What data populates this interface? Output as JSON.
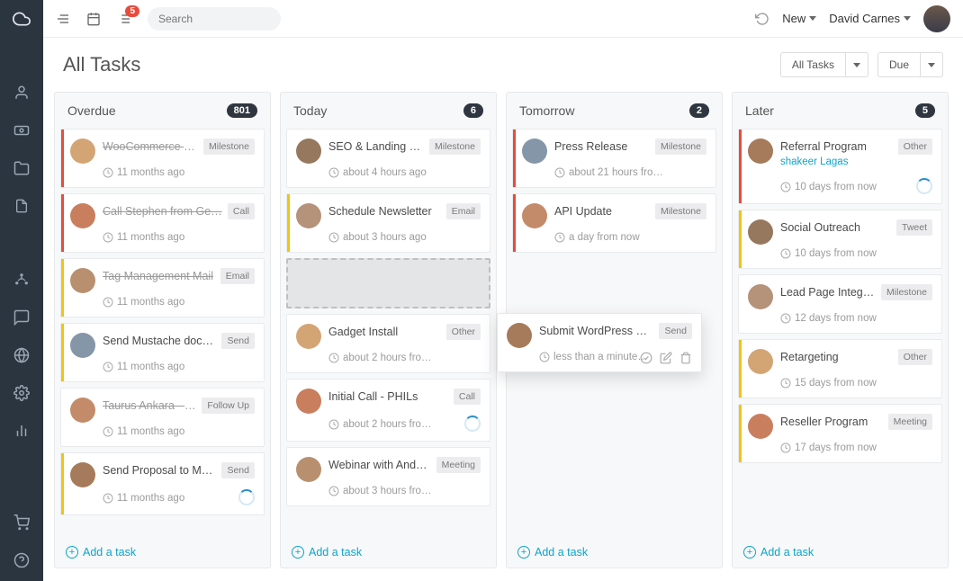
{
  "top": {
    "search_placeholder": "Search",
    "badge": "5",
    "new": "New",
    "user": "David Carnes"
  },
  "header": {
    "title": "All Tasks",
    "filter": "All Tasks",
    "sort": "Due"
  },
  "add_task": "Add a task",
  "columns": [
    {
      "title": "Overdue",
      "count": "801",
      "cards": [
        {
          "stripe": "r",
          "title": "WooCommerce Blog",
          "tag": "Milestone",
          "meta": "11 months ago",
          "done": true
        },
        {
          "stripe": "r",
          "title": "Call Stephen from Ge…",
          "tag": "Call",
          "meta": "11 months ago",
          "done": true
        },
        {
          "stripe": "y",
          "title": "Tag Management Mail",
          "tag": "Email",
          "meta": "11 months ago",
          "done": true
        },
        {
          "stripe": "y",
          "title": "Send Mustache docu…",
          "tag": "Send",
          "meta": "11 months ago"
        },
        {
          "stripe": "n",
          "title": "Taurus Ankara - Foll…",
          "tag": "Follow Up",
          "meta": "11 months ago",
          "done": true
        },
        {
          "stripe": "y",
          "title": "Send Proposal to Mo…",
          "tag": "Send",
          "meta": "11 months ago",
          "spinner": true
        }
      ]
    },
    {
      "title": "Today",
      "count": "6",
      "cards": [
        {
          "stripe": "n",
          "title": "SEO & Landing page",
          "tag": "Milestone",
          "meta": "about 4 hours ago"
        },
        {
          "stripe": "y",
          "title": "Schedule Newsletter",
          "tag": "Email",
          "meta": "about 3 hours ago"
        },
        {
          "drop": true
        },
        {
          "stripe": "n",
          "title": "Gadget Install",
          "tag": "Other",
          "meta": "about 2 hours fro…"
        },
        {
          "stripe": "n",
          "title": "Initial Call - PHILs",
          "tag": "Call",
          "meta": "about 2 hours fro…",
          "spinner": true
        },
        {
          "stripe": "n",
          "title": "Webinar with Andrea",
          "tag": "Meeting",
          "meta": "about 3 hours fro…"
        }
      ]
    },
    {
      "title": "Tomorrow",
      "count": "2",
      "cards": [
        {
          "stripe": "r",
          "title": "Press Release",
          "tag": "Milestone",
          "meta": "about 21 hours fro…"
        },
        {
          "stripe": "r",
          "title": "API Update",
          "tag": "Milestone",
          "meta": "a day from now"
        }
      ]
    },
    {
      "title": "Later",
      "count": "5",
      "cards": [
        {
          "stripe": "r",
          "title": "Referral Program",
          "sub": "shakeer Lagas",
          "tag": "Other",
          "meta": "10 days from now",
          "spinner": true
        },
        {
          "stripe": "y",
          "title": "Social Outreach",
          "tag": "Tweet",
          "meta": "10 days from now"
        },
        {
          "stripe": "n",
          "title": "Lead Page Integration",
          "tag": "Milestone",
          "meta": "12 days from now"
        },
        {
          "stripe": "y",
          "title": "Retargeting",
          "tag": "Other",
          "meta": "15 days from now"
        },
        {
          "stripe": "y",
          "title": "Reseller Program",
          "tag": "Meeting",
          "meta": "17 days from now"
        }
      ]
    }
  ],
  "floating": {
    "title": "Submit WordPress Pl…",
    "tag": "Send",
    "meta": "less than a minute…"
  }
}
